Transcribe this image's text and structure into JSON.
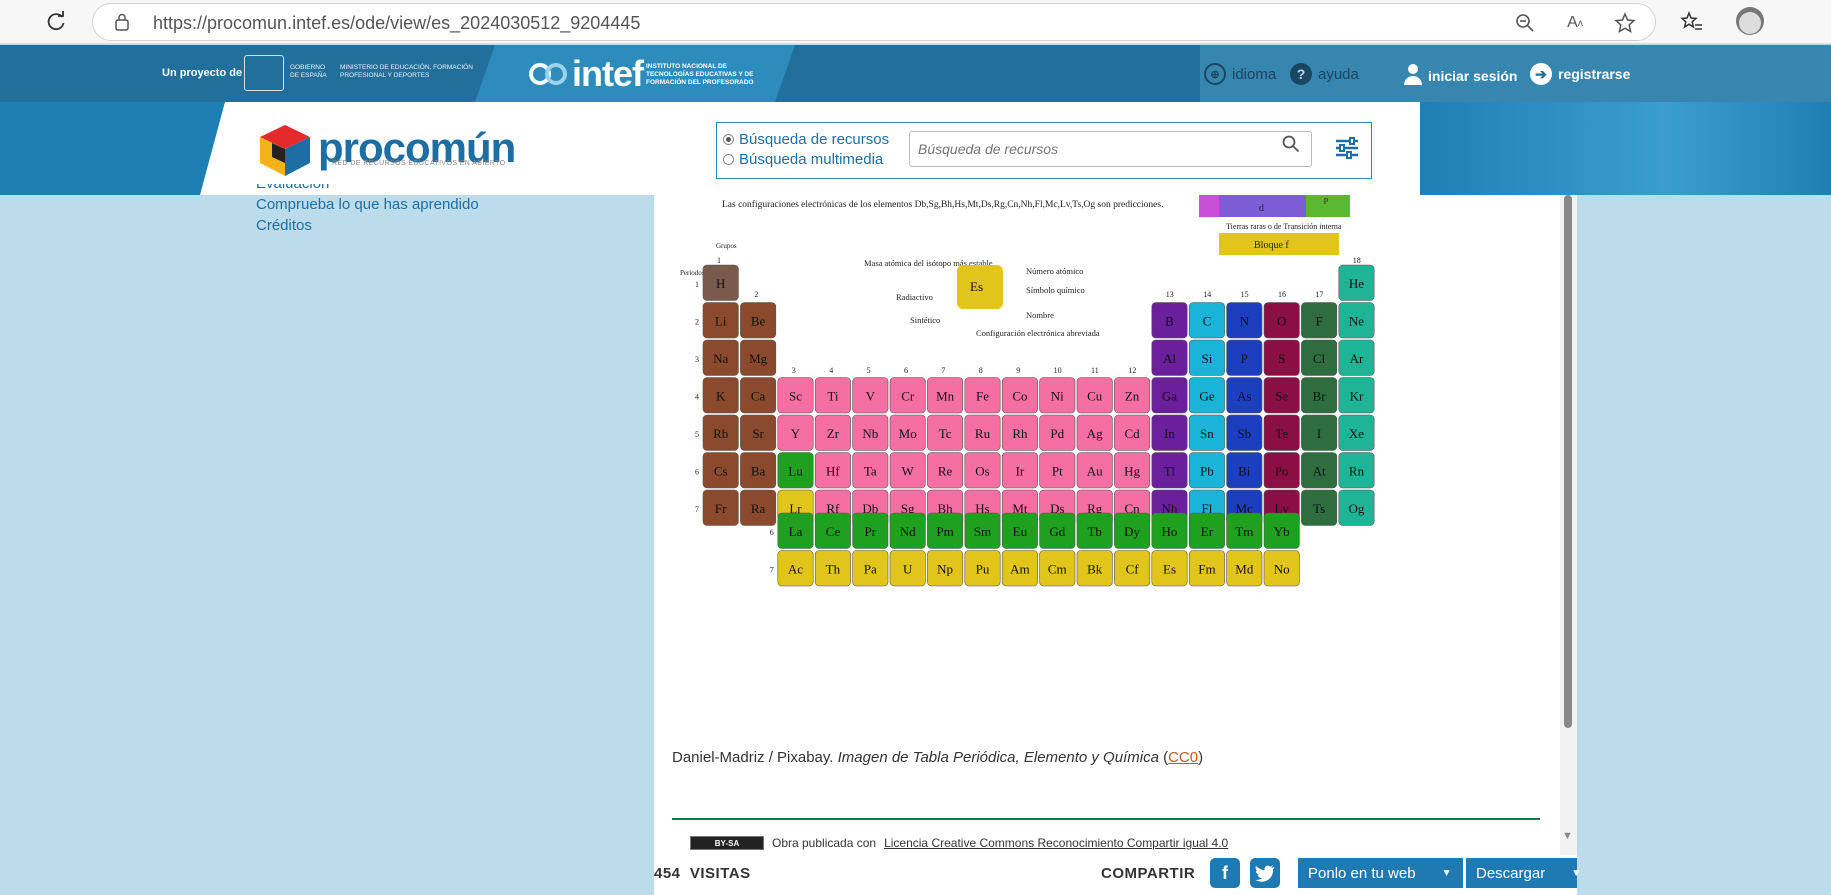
{
  "browser": {
    "url": "https://procomun.intef.es/ode/view/es_2024030512_9204445"
  },
  "topbar": {
    "proyecto": "Un proyecto de",
    "gob_text": "GOBIERNO DE ESPAÑA",
    "ministerio": "MINISTERIO DE EDUCACIÓN, FORMACIÓN PROFESIONAL Y DEPORTES",
    "intef": "intef",
    "intef_sub": "INSTITUTO NACIONAL DE TECNOLOGÍAS EDUCATIVAS Y DE FORMACIÓN DEL PROFESORADO",
    "idioma": "idioma",
    "ayuda": "ayuda",
    "login": "iniciar sesión",
    "register": "registrarse"
  },
  "header": {
    "logo": "procomún",
    "logo_sub": "RED DE RECURSOS EDUCATIVOS EN ABIERTO",
    "radio_recursos": "Búsqueda de recursos",
    "radio_multimedia": "Búsqueda multimedia",
    "search_placeholder": "Búsqueda de recursos"
  },
  "leftnav": {
    "items": [
      "Evaluación",
      "Comprueba lo que has aprendido",
      "Créditos"
    ]
  },
  "table": {
    "note": "Las configuraciones electrónicas de los elementos Db,Sg,Bh,Hs,Mt,Ds,Rg,Cn,Nh,Fl,Mc,Lv,Ts,Og son predicciones.",
    "grupos": "Grupos",
    "periodos": "Periodos",
    "legend_masa": "Masa atómica del isótopo más estable",
    "legend_radiactivo": "Radiactivo",
    "legend_sintetico": "Sintético",
    "legend_numero": "Número atómico",
    "legend_simbolo": "Símbolo químico",
    "legend_nombre": "Nombre",
    "legend_config": "Configuración electrónica abreviada",
    "tierras_raras": "Tierras raras o de Transición interna",
    "bloque_f": "Bloque f",
    "bloque_d": "d",
    "bloque_p": "p"
  },
  "credit": {
    "author": "Daniel-Madriz / Pixabay.",
    "title": "Imagen de Tabla Periódica, Elemento y Química",
    "license": "CC0",
    "open": "(",
    "close": ")"
  },
  "license_footer": {
    "badge": "BY-SA",
    "text": "Obra publicada con",
    "link": "Licencia Creative Commons Reconocimiento Compartir igual 4.0"
  },
  "bottombar": {
    "visitas": "454  VISITAS",
    "compartir": "COMPARTIR",
    "embed": "Ponlo en tu web",
    "download": "Descargar"
  },
  "colors": {
    "brand_blue": "#1f79b2",
    "alkali": "#8b4a2e",
    "transition": "#f56fa3",
    "lanthanide": "#1fa11f",
    "actinide": "#e2c51a",
    "halogen": "#2e6e3e",
    "noble": "#1db596"
  }
}
